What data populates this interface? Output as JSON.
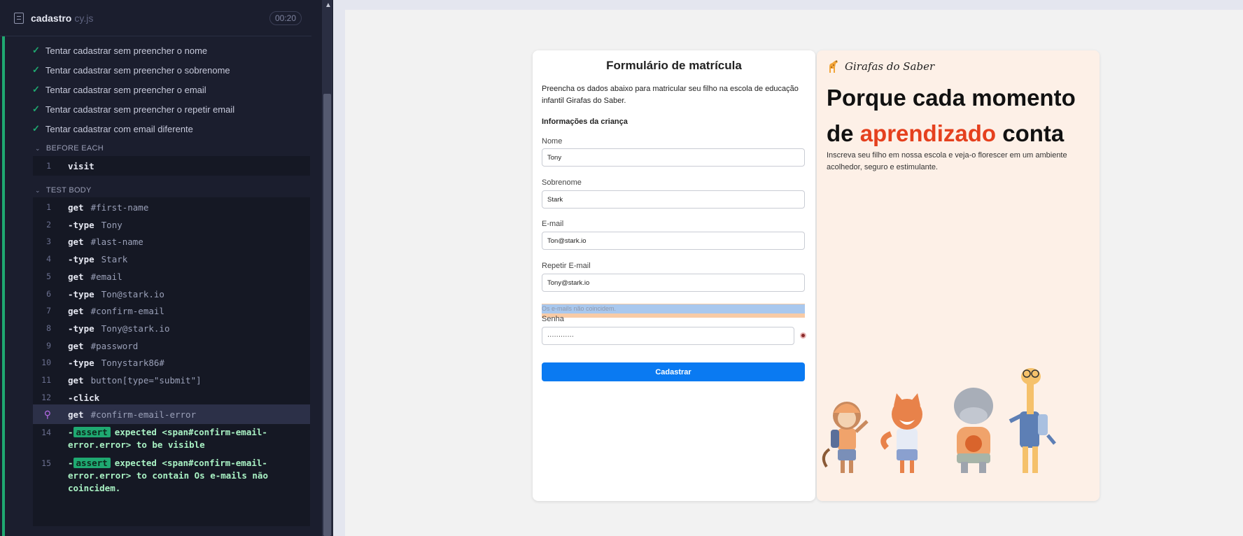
{
  "runner": {
    "spec_name": "cadastro",
    "spec_ext": "cy.js",
    "timer": "00:20",
    "passed_tests": [
      "Tentar cadastrar sem preencher o nome",
      "Tentar cadastrar sem preencher o sobrenome",
      "Tentar cadastrar sem preencher o email",
      "Tentar cadastrar sem preencher o repetir email",
      "Tentar cadastrar com email diferente"
    ],
    "before_each_label": "BEFORE EACH",
    "before_each_cmds": [
      {
        "num": "1",
        "name": "visit",
        "arg": ""
      }
    ],
    "test_body_label": "TEST BODY",
    "test_body_cmds": [
      {
        "num": "1",
        "name": "get",
        "arg": "#first-name"
      },
      {
        "num": "2",
        "name": "-type",
        "arg": "Tony"
      },
      {
        "num": "3",
        "name": "get",
        "arg": "#last-name"
      },
      {
        "num": "4",
        "name": "-type",
        "arg": "Stark"
      },
      {
        "num": "5",
        "name": "get",
        "arg": "#email"
      },
      {
        "num": "6",
        "name": "-type",
        "arg": "Ton@stark.io"
      },
      {
        "num": "7",
        "name": "get",
        "arg": "#confirm-email"
      },
      {
        "num": "8",
        "name": "-type",
        "arg": "Tony@stark.io"
      },
      {
        "num": "9",
        "name": "get",
        "arg": "#password"
      },
      {
        "num": "10",
        "name": "-type",
        "arg": "Tonystark86#"
      },
      {
        "num": "11",
        "name": "get",
        "arg": "button[type=\"submit\"]"
      },
      {
        "num": "12",
        "name": "-click",
        "arg": ""
      },
      {
        "num": "",
        "name": "get",
        "arg": "#confirm-email-error"
      }
    ],
    "asserts": [
      {
        "num": "14",
        "prefix": "-",
        "badge": "assert",
        "lines": [
          "expected <span#confirm-email-",
          "error.error> to be visible"
        ]
      },
      {
        "num": "15",
        "prefix": "-",
        "badge": "assert",
        "lines": [
          "expected <span#confirm-email-",
          "error.error> to contain Os e-mails não",
          "coincidem."
        ]
      }
    ]
  },
  "form": {
    "title": "Formulário de matrícula",
    "intro": "Preencha os dados abaixo para matricular seu filho na escola de educação infantil Girafas do Saber.",
    "section": "Informações da criança",
    "fields": [
      {
        "label": "Nome",
        "value": "Tony"
      },
      {
        "label": "Sobrenome",
        "value": "Stark"
      },
      {
        "label": "E-mail",
        "value": "Ton@stark.io"
      },
      {
        "label": "Repetir E-mail",
        "value": "Tony@stark.io"
      }
    ],
    "error": "Os e-mails não coincidem.",
    "password_label": "Senha",
    "password_value": "············",
    "submit": "Cadastrar"
  },
  "promo": {
    "brand": "Girafas do Saber",
    "headline_part1": "Porque cada momento de ",
    "headline_accent": "aprendizado",
    "headline_part2": " conta",
    "sub": "Inscreva seu filho em nossa escola e veja-o florescer em um ambiente acolhedor, seguro e estimulante."
  },
  "colors": {
    "accent": "#e5401e",
    "button": "#0a7af2",
    "pass": "#1fa971"
  }
}
